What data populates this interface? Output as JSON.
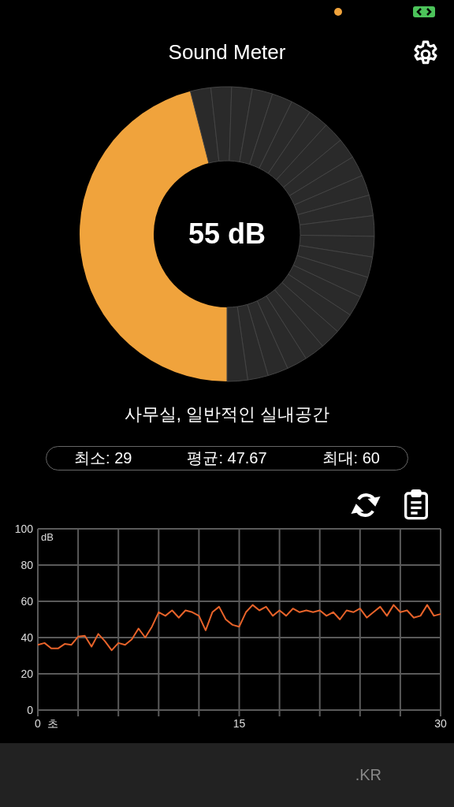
{
  "app_bar": {
    "title": "Sound Meter"
  },
  "gauge": {
    "reading": "55 dB",
    "level": 0.46
  },
  "environment": "사무실, 일반적인 실내공간",
  "stats": [
    {
      "label": "최소:",
      "value": "29"
    },
    {
      "label": "평균:",
      "value": "47.67"
    },
    {
      "label": "최대:",
      "value": "60"
    }
  ],
  "history": {
    "chart_data": {
      "type": "line",
      "xlabel": "초",
      "grid": true,
      "xlim": [
        0,
        30
      ],
      "ylim": [
        0,
        100
      ],
      "xticks": [
        0,
        15,
        30
      ],
      "yticks": [
        0,
        20,
        40,
        60,
        80,
        100
      ],
      "x": [
        0,
        0.5,
        1,
        1.5,
        2,
        2.5,
        3,
        3.5,
        4,
        4.5,
        5,
        5.5,
        6,
        6.5,
        7,
        7.5,
        8,
        8.5,
        9,
        9.5,
        10,
        10.5,
        11,
        11.5,
        12,
        12.5,
        13,
        13.5,
        14,
        14.5,
        15,
        15.5,
        16,
        16.5,
        17,
        17.5,
        18,
        18.5,
        19,
        19.5,
        20,
        20.5,
        21,
        21.5,
        22,
        22.5,
        23,
        23.5,
        24,
        24.5,
        25,
        25.5,
        26,
        26.5,
        27,
        27.5,
        28,
        28.5,
        29,
        29.5,
        30
      ],
      "series": [
        {
          "name": "dB",
          "color": "#e8632a",
          "values": [
            36,
            37,
            34,
            34,
            36.5,
            36,
            40.5,
            41,
            35,
            42,
            38,
            33,
            37,
            36,
            39,
            45,
            40,
            46,
            54,
            52,
            55,
            51,
            55,
            54,
            52,
            44,
            54,
            57,
            50,
            47,
            46,
            54,
            58,
            55,
            57,
            52,
            55,
            52,
            56,
            54,
            55,
            54,
            55,
            52,
            54,
            50,
            55,
            54,
            56,
            51,
            54,
            57,
            52,
            58,
            54,
            55,
            51,
            52,
            58,
            52,
            53
          ]
        }
      ]
    }
  },
  "banner": {
    "text": ".KR"
  }
}
